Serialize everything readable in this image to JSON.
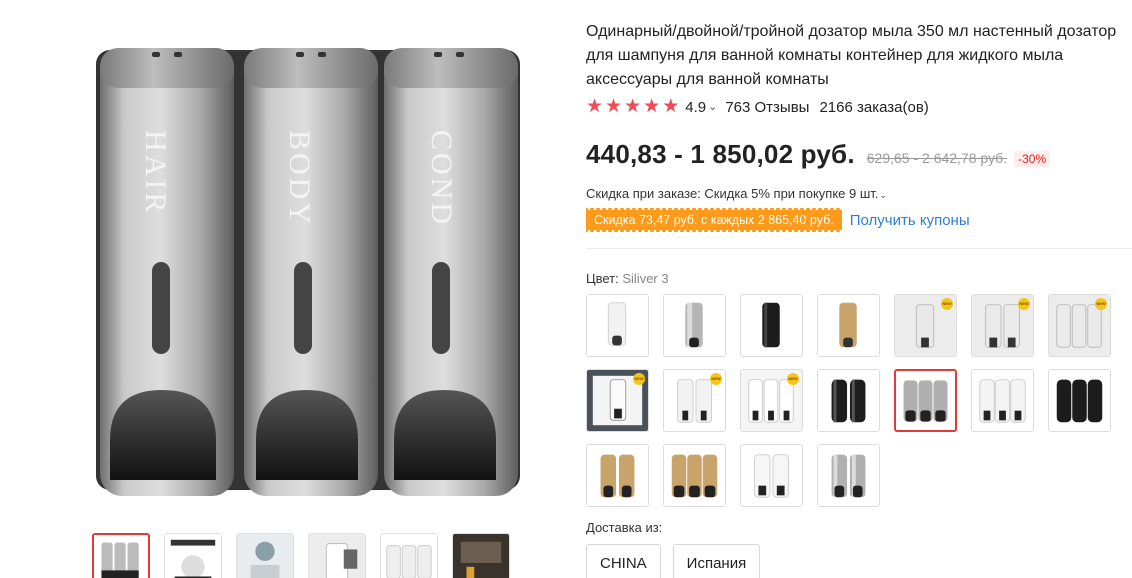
{
  "product": {
    "title": "Одинарный/двойной/тройной дозатор мыла 350 мл настенный дозатор для шампуня для ванной комнаты контейнер для жидкого мыла аксессуары для ванной комнаты",
    "image_labels": [
      "HAIR",
      "BODY",
      "COND"
    ]
  },
  "rating": {
    "value": "4.9",
    "stars": 5,
    "reviews": "763 Отзывы",
    "orders": "2166 заказа(ов)"
  },
  "price": {
    "current": "440,83 - 1 850,02 руб.",
    "old": "629,65 - 2 642,78 руб.",
    "discount": "-30%"
  },
  "bulk_discount": "Скидка при заказе: Скидка 5% при покупке 9 шт.",
  "coupon": {
    "badge": "Скидка 73,47 руб. с каждых 2 865,40 руб.",
    "link": "Получить купоны"
  },
  "color": {
    "label": "Цвет: ",
    "selected": "Siliver 3",
    "options": [
      {
        "name": "white-1",
        "new": false
      },
      {
        "name": "silver-1",
        "new": false
      },
      {
        "name": "black-1",
        "new": false
      },
      {
        "name": "gold-1",
        "new": false
      },
      {
        "name": "silver-1-new",
        "new": true
      },
      {
        "name": "silver-2-new",
        "new": true
      },
      {
        "name": "silver-3-new",
        "new": true
      },
      {
        "name": "black-1-new",
        "new": true
      },
      {
        "name": "white-2-new",
        "new": true
      },
      {
        "name": "white-3-new",
        "new": true
      },
      {
        "name": "black-2",
        "new": false
      },
      {
        "name": "silver-3",
        "new": false
      },
      {
        "name": "white-3",
        "new": false
      },
      {
        "name": "black-3",
        "new": false
      },
      {
        "name": "gold-2",
        "new": false
      },
      {
        "name": "gold-3",
        "new": false
      },
      {
        "name": "white-2",
        "new": false
      },
      {
        "name": "silver-2",
        "new": false
      }
    ],
    "new_tag": "NEW"
  },
  "shipping": {
    "label": "Доставка из:",
    "options": [
      "CHINA",
      "Испания"
    ]
  },
  "colors": {
    "accent_red": "#f44a55",
    "discount_red": "#e02020",
    "coupon_orange": "#ff9a1a",
    "link_blue": "#2a7fd4",
    "selected_border": "#e03a3a"
  }
}
